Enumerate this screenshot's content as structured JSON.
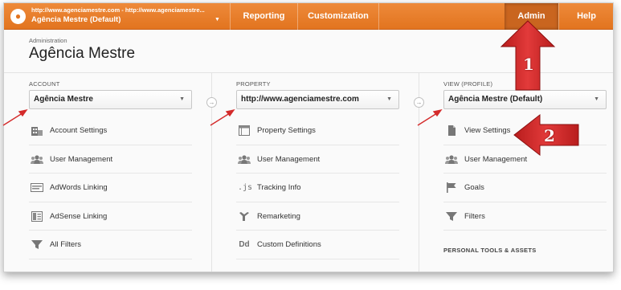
{
  "topbar": {
    "account_url": "http://www.agenciamestre.com - http://www.agenciamestre...",
    "account_view": "Agência Mestre (Default)",
    "nav": [
      "Reporting",
      "Customization"
    ],
    "admin": "Admin",
    "help": "Help",
    "accent_color": "#e2741f"
  },
  "header": {
    "breadcrumb": "Administration",
    "title": "Agência Mestre"
  },
  "account": {
    "label": "ACCOUNT",
    "selected": "Agência Mestre",
    "items": [
      {
        "label": "Account Settings",
        "icon": "building-icon"
      },
      {
        "label": "User Management",
        "icon": "users-icon"
      },
      {
        "label": "AdWords Linking",
        "icon": "adwords-icon"
      },
      {
        "label": "AdSense Linking",
        "icon": "adsense-icon"
      },
      {
        "label": "All Filters",
        "icon": "filter-icon"
      }
    ]
  },
  "property": {
    "label": "PROPERTY",
    "selected": "http://www.agenciamestre.com",
    "items": [
      {
        "label": "Property Settings",
        "icon": "window-icon"
      },
      {
        "label": "User Management",
        "icon": "users-icon"
      },
      {
        "label": "Tracking Info",
        "icon": "js-icon",
        "glyph": ".js"
      },
      {
        "label": "Remarketing",
        "icon": "remarketing-icon"
      },
      {
        "label": "Custom Definitions",
        "icon": "dd-icon",
        "glyph": "Dd"
      }
    ]
  },
  "view": {
    "label": "VIEW (PROFILE)",
    "selected": "Agência Mestre (Default)",
    "items": [
      {
        "label": "View Settings",
        "icon": "document-icon"
      },
      {
        "label": "User Management",
        "icon": "users-icon"
      },
      {
        "label": "Goals",
        "icon": "flag-icon"
      },
      {
        "label": "Filters",
        "icon": "filter-icon"
      }
    ],
    "section": "PERSONAL TOOLS & ASSETS"
  },
  "annotations": {
    "step1": "1",
    "step2": "2",
    "arrow_color": "#d42b2b"
  }
}
